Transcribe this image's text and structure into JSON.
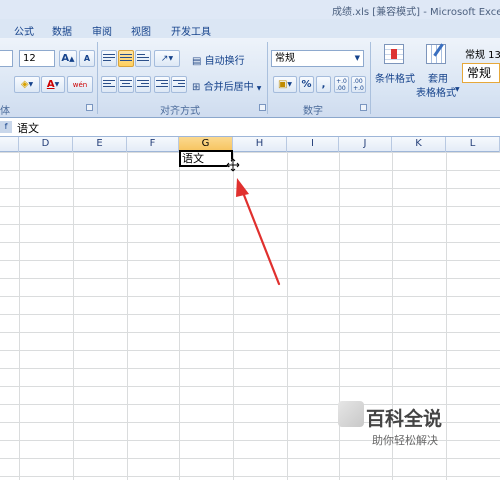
{
  "window": {
    "title": "成绩.xls [兼容模式] - Microsoft Exce"
  },
  "tabs": [
    "公式",
    "数据",
    "审阅",
    "视图",
    "开发工具"
  ],
  "ribbon": {
    "font_group": {
      "label": "体",
      "font_size": "12",
      "grow_font": "A",
      "shrink_font": "A",
      "font_color_label": "A",
      "phonetic_label": "wén"
    },
    "alignment_group": {
      "label": "对齐方式",
      "wrap_text": "自动换行",
      "merge_center": "合并后居中"
    },
    "number_group": {
      "label": "数字",
      "format_value": "常规",
      "percent": "%",
      "comma": ",",
      "inc_decimal": "+.0\n.00",
      "dec_decimal": ".00\n+.0"
    },
    "styles_group": {
      "conditional_format": "条件格式",
      "format_table_top": "套用",
      "format_table_bottom": "表格格式",
      "style_box_top": "常规 13",
      "style_box_value": "常规"
    }
  },
  "formula_bar": {
    "value": "语文"
  },
  "columns": [
    "D",
    "E",
    "F",
    "G",
    "H",
    "I",
    "J",
    "K",
    "L"
  ],
  "selected_column": "G",
  "active_cell": {
    "text": "语文"
  },
  "watermark": {
    "title": "百科全说",
    "subtitle": "助你轻松解决"
  },
  "colors": {
    "annotation_arrow": "#e0302e",
    "selected_header": "#f6c25b",
    "ribbon_text": "#15428b"
  }
}
